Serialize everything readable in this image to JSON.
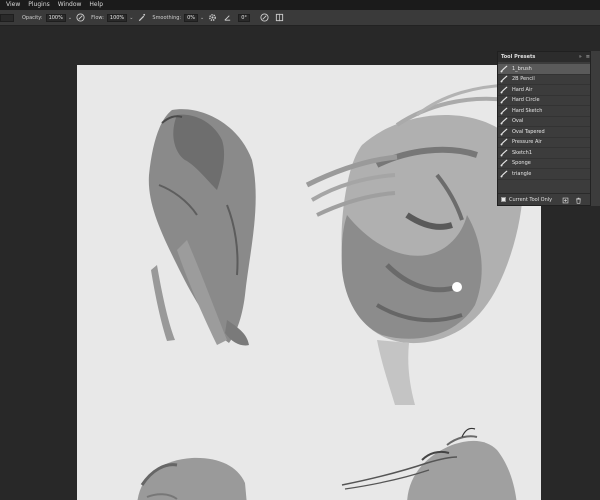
{
  "menu": [
    "View",
    "Plugins",
    "Window",
    "Help"
  ],
  "options": {
    "opacity_label": "Opacity:",
    "opacity_value": "100%",
    "flow_label": "Flow:",
    "flow_value": "100%",
    "smoothing_label": "Smoothing:",
    "smoothing_value": "0%",
    "angle_value": "0°"
  },
  "panel": {
    "title": "Tool Presets",
    "presets": [
      "1_brush",
      "2B Pencil",
      "Hard Air",
      "Hard Circle",
      "Hard Sketch",
      "Oval",
      "Oval Tapered",
      "Pressure Air",
      "Sketch1",
      "Sponge",
      "triangle"
    ],
    "selected_index": 0,
    "current_tool_only_label": "Current Tool Only"
  }
}
